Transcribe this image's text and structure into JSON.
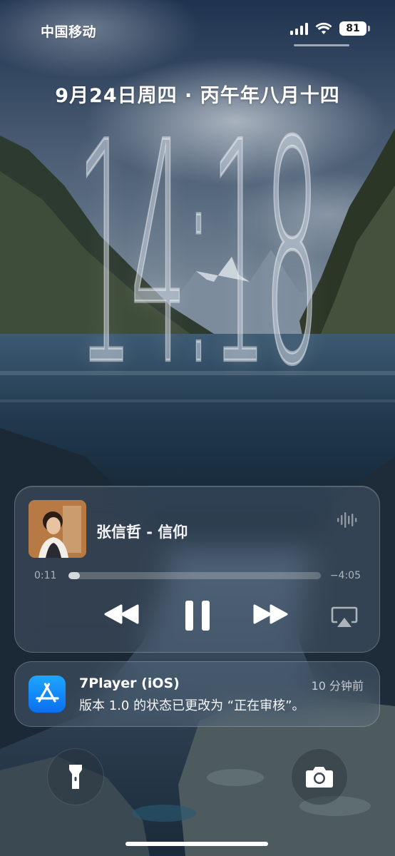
{
  "status_bar": {
    "carrier": "中国移动",
    "battery_level": "81",
    "signal_icon": "cellular-signal-icon",
    "wifi_icon": "wifi-icon"
  },
  "lock_screen": {
    "date": "9月24日周四 · 丙午年八月十四",
    "time": "14:18"
  },
  "now_playing": {
    "title": "张信哲 - 信仰",
    "elapsed": "0:11",
    "remaining": "−4:05",
    "progress": 0.045,
    "controls": {
      "rewind_icon": "rewind-icon",
      "pause_icon": "pause-icon",
      "forward_icon": "fast-forward-icon",
      "airplay_icon": "airplay-icon",
      "waveform_icon": "waveform-icon"
    }
  },
  "notification": {
    "app": "7Player (iOS)",
    "time": "10 分钟前",
    "body": "版本 1.0 的状态已更改为 “正在审核”。",
    "icon": "app-store-icon"
  },
  "quick_actions": {
    "left_icon": "flashlight-icon",
    "right_icon": "camera-icon"
  }
}
